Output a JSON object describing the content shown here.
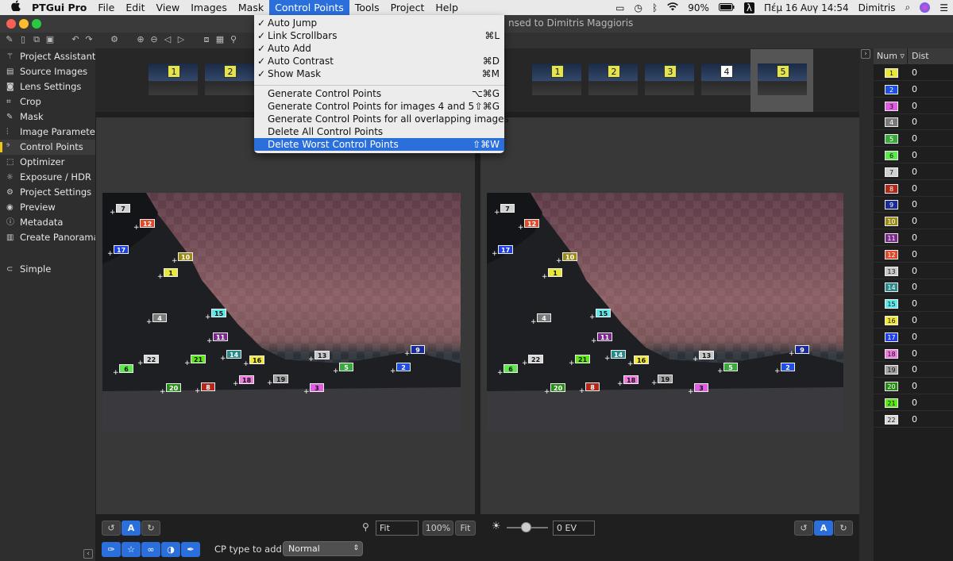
{
  "menubar": {
    "apple": "",
    "items": [
      "PTGui Pro",
      "File",
      "Edit",
      "View",
      "Images",
      "Mask",
      "Control Points",
      "Tools",
      "Project",
      "Help"
    ],
    "status": {
      "battery": "90%",
      "lambda": "λ",
      "datetime": "Πέμ 16 Αυγ  14:54",
      "user": "Dimitris"
    }
  },
  "title": {
    "text": "nsed to Dimitris Maggioris"
  },
  "sidebar": {
    "items": [
      {
        "label": "Project Assistant",
        "icon": "wand-icon"
      },
      {
        "label": "Source Images",
        "icon": "images-icon"
      },
      {
        "label": "Lens Settings",
        "icon": "camera-icon"
      },
      {
        "label": "Crop",
        "icon": "crop-icon"
      },
      {
        "label": "Mask",
        "icon": "brush-icon"
      },
      {
        "label": "Image Parameters",
        "icon": "sliders-icon"
      },
      {
        "label": "Control Points",
        "icon": "control-points-icon"
      },
      {
        "label": "Optimizer",
        "icon": "optimizer-icon"
      },
      {
        "label": "Exposure / HDR",
        "icon": "sun-icon"
      },
      {
        "label": "Project Settings",
        "icon": "gear-icon"
      },
      {
        "label": "Preview",
        "icon": "eye-icon"
      },
      {
        "label": "Metadata",
        "icon": "info-icon"
      },
      {
        "label": "Create Panorama",
        "icon": "panorama-icon"
      }
    ],
    "simple": "Simple"
  },
  "menu": {
    "items": [
      {
        "label": "Auto Jump",
        "checked": true,
        "shortcut": ""
      },
      {
        "label": "Link Scrollbars",
        "checked": true,
        "shortcut": "⌘L"
      },
      {
        "label": "Auto Add",
        "checked": true,
        "shortcut": ""
      },
      {
        "label": "Auto Contrast",
        "checked": true,
        "shortcut": "⌘D"
      },
      {
        "label": "Show Mask",
        "checked": true,
        "shortcut": "⌘M"
      },
      {
        "label": "Generate Control Points",
        "checked": false,
        "shortcut": "⌥⌘G"
      },
      {
        "label": "Generate Control Points for images 4 and 5",
        "checked": false,
        "shortcut": "⇧⌘G"
      },
      {
        "label": "Generate Control Points for all overlapping images",
        "checked": false,
        "shortcut": ""
      },
      {
        "label": "Delete All Control Points",
        "checked": false,
        "shortcut": ""
      },
      {
        "label": "Delete Worst Control Points",
        "checked": false,
        "shortcut": "⇧⌘W"
      }
    ],
    "check_mark": "✓"
  },
  "thumbs_left": [
    "1",
    "2"
  ],
  "thumbs_right": [
    "1",
    "2",
    "3",
    "4",
    "5"
  ],
  "table": {
    "headers": {
      "num": "Num",
      "dist": "Dist"
    },
    "rows": [
      {
        "num": "1",
        "dist": "0",
        "color": "#e8e83a"
      },
      {
        "num": "2",
        "dist": "0",
        "color": "#1f4fe0"
      },
      {
        "num": "3",
        "dist": "0",
        "color": "#e05ce0"
      },
      {
        "num": "4",
        "dist": "0",
        "color": "#7a7a7a"
      },
      {
        "num": "5",
        "dist": "0",
        "color": "#3aa83a"
      },
      {
        "num": "6",
        "dist": "0",
        "color": "#5ee84e"
      },
      {
        "num": "7",
        "dist": "0",
        "color": "#d0d0d0"
      },
      {
        "num": "8",
        "dist": "0",
        "color": "#b0281a"
      },
      {
        "num": "9",
        "dist": "0",
        "color": "#1a2a9a"
      },
      {
        "num": "10",
        "dist": "0",
        "color": "#9a8a18"
      },
      {
        "num": "11",
        "dist": "0",
        "color": "#7a2a8a"
      },
      {
        "num": "12",
        "dist": "0",
        "color": "#e04a2a"
      },
      {
        "num": "13",
        "dist": "0",
        "color": "#c8c8c8"
      },
      {
        "num": "14",
        "dist": "0",
        "color": "#2a8a8a"
      },
      {
        "num": "15",
        "dist": "0",
        "color": "#5ee8e8"
      },
      {
        "num": "16",
        "dist": "0",
        "color": "#f0e83a"
      },
      {
        "num": "17",
        "dist": "0",
        "color": "#1f3fe8"
      },
      {
        "num": "18",
        "dist": "0",
        "color": "#f07ae0"
      },
      {
        "num": "19",
        "dist": "0",
        "color": "#a0a0a0"
      },
      {
        "num": "20",
        "dist": "0",
        "color": "#2a8a1a"
      },
      {
        "num": "21",
        "dist": "0",
        "color": "#5ee81a"
      },
      {
        "num": "22",
        "dist": "0",
        "color": "#d8d8d8"
      }
    ]
  },
  "controls": {
    "fit_field": "Fit",
    "zoom_100": "100%",
    "fit_button": "Fit",
    "ev_field": "0 EV",
    "a_label": "A",
    "cp_type_label": "CP type to add:",
    "cp_type_value": "Normal"
  }
}
